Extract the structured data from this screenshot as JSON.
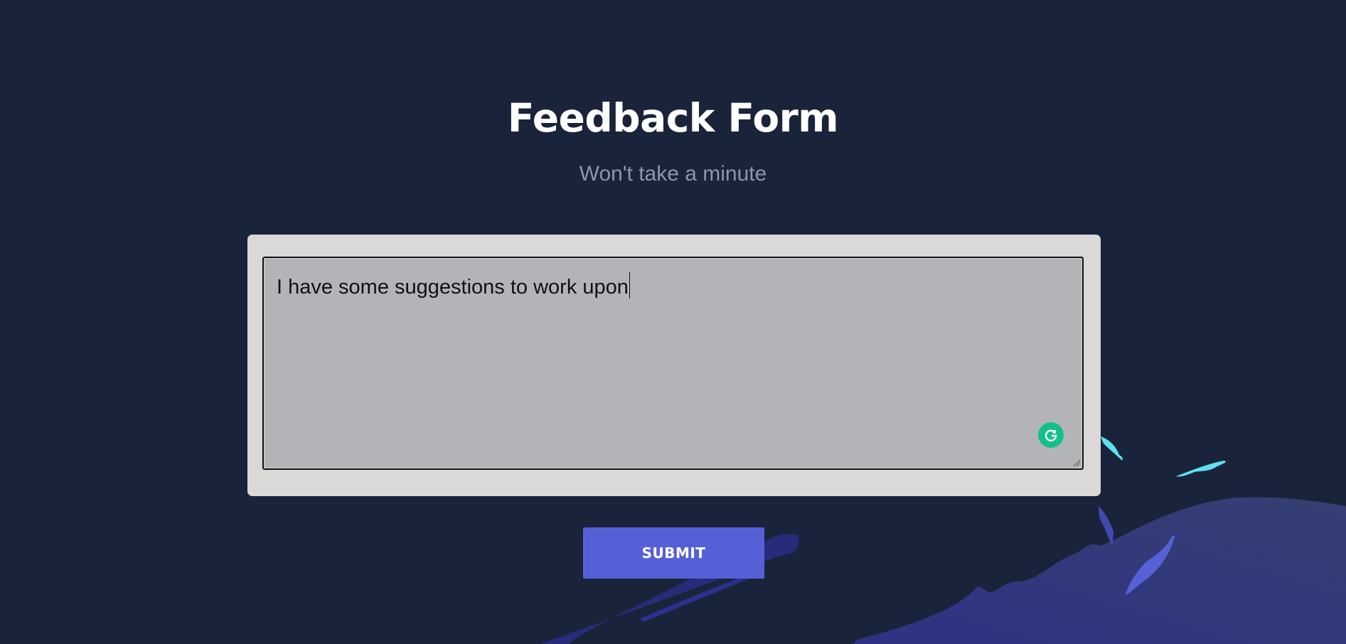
{
  "form": {
    "title": "Feedback Form",
    "subtitle": "Won't take a minute",
    "textarea_value": "I have some suggestions to work upon",
    "submit_label": "SUBMIT"
  },
  "icons": {
    "grammarly": "grammarly-g-icon",
    "resize": "resize-handle-icon"
  },
  "colors": {
    "background": "#19243a",
    "card": "#dbd8d8",
    "textarea": "#b3b4b8",
    "submit_button": "#5660d6",
    "subtitle": "#8a97ad",
    "grammarly": "#15bf8b"
  }
}
